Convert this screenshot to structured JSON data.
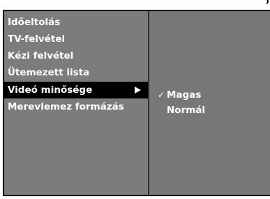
{
  "menu": {
    "items": [
      {
        "label": "Időeltolás"
      },
      {
        "label": "TV-felvétel"
      },
      {
        "label": "Kézi felvétel"
      },
      {
        "label": "Ütemezett lista"
      },
      {
        "label": "Videó minősége",
        "selected": true
      },
      {
        "label": "Merevlemez formázás"
      }
    ]
  },
  "submenu": {
    "check_glyph": "✓",
    "options": [
      {
        "label": "Magas",
        "checked": true
      },
      {
        "label": "Normál",
        "checked": false
      }
    ]
  },
  "icons": {
    "submenu_arrow": "triangle-right-icon",
    "checkmark": "checkmark-icon"
  },
  "colors": {
    "panel_bg": "#7c7c7c",
    "highlight_bg": "#000000",
    "text": "#ffffff"
  }
}
